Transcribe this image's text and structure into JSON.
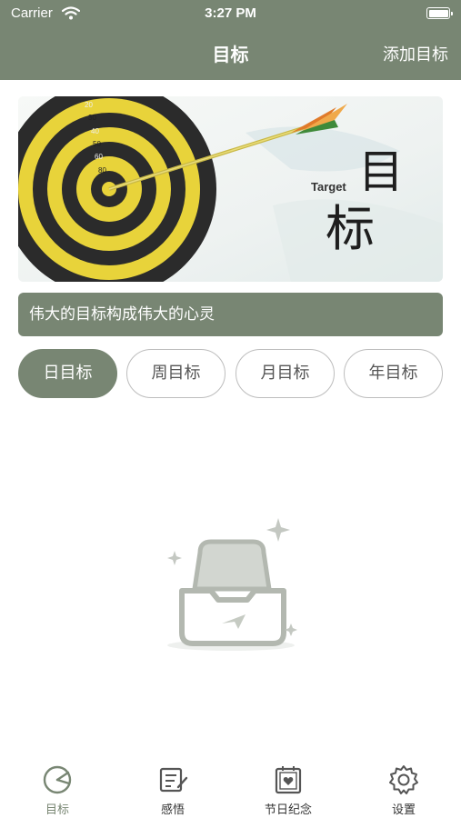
{
  "status_bar": {
    "carrier": "Carrier",
    "time": "3:27 PM"
  },
  "nav": {
    "title": "目标",
    "add_label": "添加目标"
  },
  "banner": {
    "word_en": "Target",
    "glyph_1": "目",
    "glyph_2": "标",
    "target_rings": [
      "20",
      "30",
      "40",
      "50",
      "60",
      "80"
    ]
  },
  "motto": "伟大的目标构成伟大的心灵",
  "tabs": [
    {
      "label": "日目标",
      "active": true
    },
    {
      "label": "周目标",
      "active": false
    },
    {
      "label": "月目标",
      "active": false
    },
    {
      "label": "年目标",
      "active": false
    }
  ],
  "tab_bar": [
    {
      "label": "目标",
      "icon": "target-icon"
    },
    {
      "label": "感悟",
      "icon": "note-icon"
    },
    {
      "label": "节日纪念",
      "icon": "calendar-heart-icon"
    },
    {
      "label": "设置",
      "icon": "gear-icon"
    }
  ],
  "colors": {
    "accent": "#788673",
    "background": "#ffffff"
  }
}
